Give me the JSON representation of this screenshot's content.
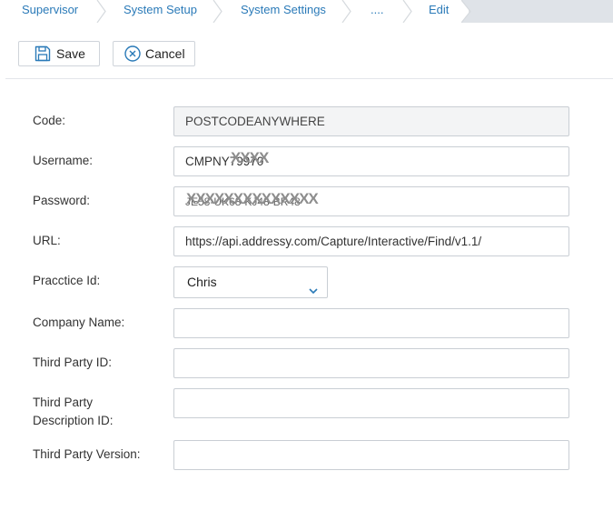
{
  "breadcrumb": {
    "items": [
      "Supervisor",
      "System Setup",
      "System Settings",
      "....",
      "Edit"
    ]
  },
  "toolbar": {
    "save_label": "Save",
    "cancel_label": "Cancel"
  },
  "form": {
    "code": {
      "label": "Code:",
      "value": "POSTCODEANYWHERE"
    },
    "username": {
      "label": "Username:",
      "value": "CMPNY79970",
      "mask": "XXXX"
    },
    "password": {
      "label": "Password:",
      "value": "JE58-UK68-KJ48-BR48",
      "mask": "XXXXXXXXXXXXXX"
    },
    "url": {
      "label": "URL:",
      "value": "https://api.addressy.com/Capture/Interactive/Find/v1.1/"
    },
    "practice_id": {
      "label": "Pracctice Id:",
      "selected": "Chris"
    },
    "company_name": {
      "label": "Company Name:",
      "value": ""
    },
    "third_party_id": {
      "label": "Third Party ID:",
      "value": ""
    },
    "third_party_description_id": {
      "label_line1": "Third Party",
      "label_line2": "Description ID:",
      "value": ""
    },
    "third_party_version": {
      "label": "Third Party Version:",
      "value": ""
    }
  },
  "colors": {
    "breadcrumb_link": "#2a7ab8",
    "breadcrumb_bg": "#dfe3e8",
    "icon_blue": "#2a7ab8",
    "input_border": "#c9ced4"
  },
  "icons": {
    "save": "floppy-disk-icon",
    "cancel": "circle-x-icon",
    "select": "chevron-down-icon"
  }
}
